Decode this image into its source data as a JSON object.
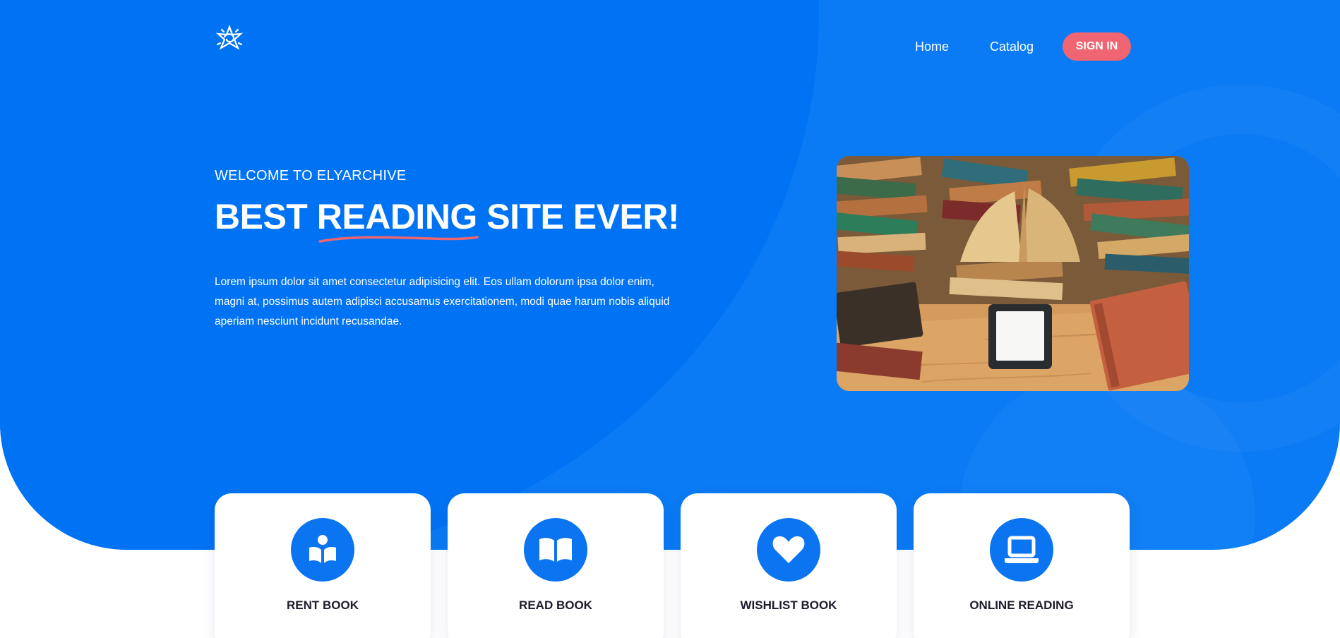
{
  "brand": {
    "logo_icon": "star-spiral-logo-icon"
  },
  "nav": {
    "home_label": "Home",
    "catalog_label": "Catalog",
    "signin_label": "SIGN IN"
  },
  "hero": {
    "eyebrow": "WELCOME TO ELYARCHIVE",
    "headline_before": "BEST ",
    "headline_highlight": "READING",
    "headline_after": " SITE EVER!",
    "paragraph": "Lorem ipsum dolor sit amet consectetur adipisicing elit. Eos ullam dolorum ipsa dolor enim, magni at, possimus autem adipisci accusamus exercitationem, modi quae harum nobis aliquid aperiam nesciunt incidunt recusandae.",
    "image_subject": "books-and-ereader-photo"
  },
  "features": [
    {
      "title": "RENT BOOK",
      "icon": "book-reader-icon"
    },
    {
      "title": "READ BOOK",
      "icon": "open-book-icon"
    },
    {
      "title": "WISHLIST BOOK",
      "icon": "heart-icon"
    },
    {
      "title": "ONLINE READING",
      "icon": "laptop-icon"
    }
  ],
  "colors": {
    "primary": "#0a7bf5",
    "accent": "#ef6571",
    "card_text": "#1c1c2c"
  }
}
